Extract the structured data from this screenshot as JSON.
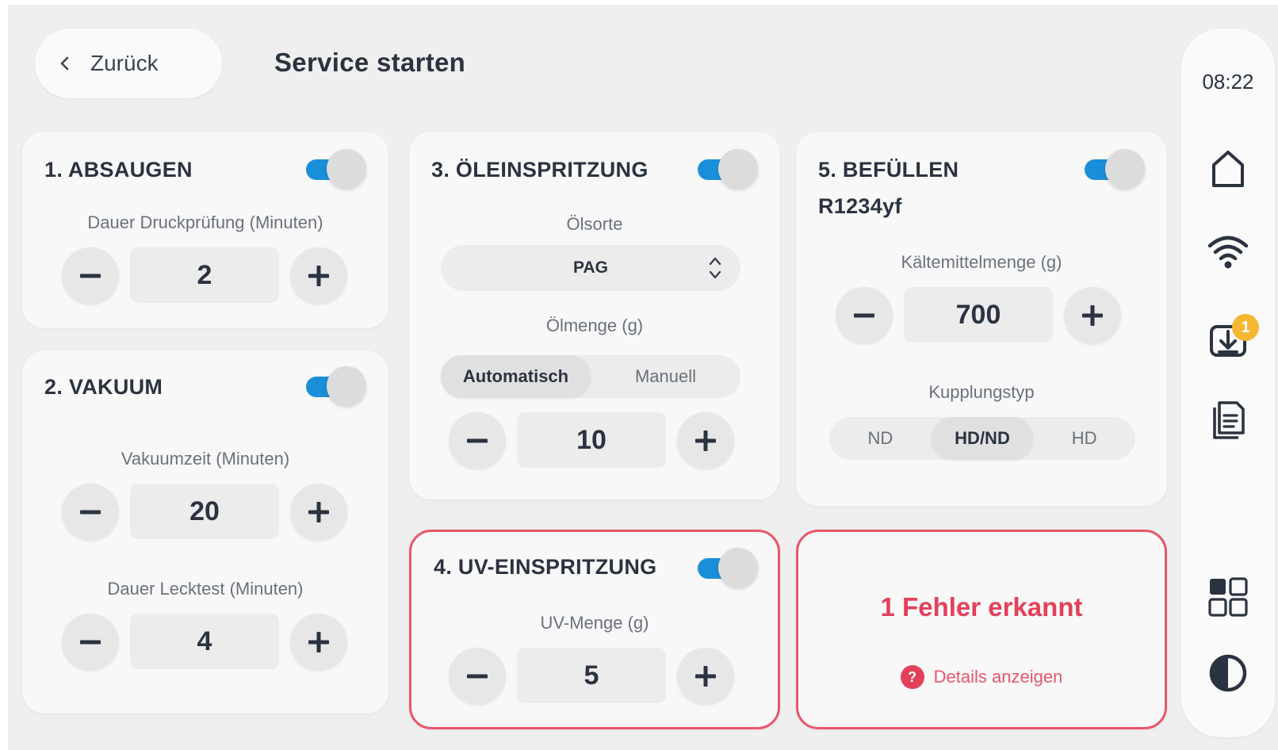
{
  "header": {
    "back_label": "Zurück",
    "title": "Service starten"
  },
  "cards": {
    "absaugen": {
      "title": "1. ABSAUGEN",
      "enabled": true,
      "field_label": "Dauer Druckprüfung (Minuten)",
      "value": "2"
    },
    "vakuum": {
      "title": "2. VAKUUM",
      "enabled": true,
      "field1_label": "Vakuumzeit (Minuten)",
      "field1_value": "20",
      "field2_label": "Dauer Lecktest (Minuten)",
      "field2_value": "4"
    },
    "oel": {
      "title": "3. ÖLEINSPRITZUNG",
      "enabled": true,
      "type_label": "Ölsorte",
      "type_value": "PAG",
      "amount_label": "Ölmenge (g)",
      "mode_options": [
        "Automatisch",
        "Manuell"
      ],
      "mode_selected": "Automatisch",
      "amount_value": "10"
    },
    "uv": {
      "title": "4. UV-EINSPRITZUNG",
      "enabled": true,
      "field_label": "UV-Menge (g)",
      "value": "5"
    },
    "befuellen": {
      "title": "5. BEFÜLLEN",
      "subtitle": "R1234yf",
      "enabled": true,
      "amount_label": "Kältemittelmenge (g)",
      "amount_value": "700",
      "coupling_label": "Kupplungstyp",
      "coupling_options": [
        "ND",
        "HD/ND",
        "HD"
      ],
      "coupling_selected": "HD/ND"
    },
    "error": {
      "title": "1 Fehler erkannt",
      "link_label": "Details anzeigen",
      "icon": "question-icon"
    }
  },
  "rail": {
    "time": "08:22",
    "icons": [
      "home-icon",
      "wifi-icon",
      "download-icon",
      "documents-icon",
      "apps-grid-icon",
      "contrast-icon"
    ],
    "download_badge": "1"
  },
  "colors": {
    "toggle_on": "#1a8fd9",
    "error": "#e3405a",
    "badge": "#f6b733",
    "background": "#efefef"
  }
}
